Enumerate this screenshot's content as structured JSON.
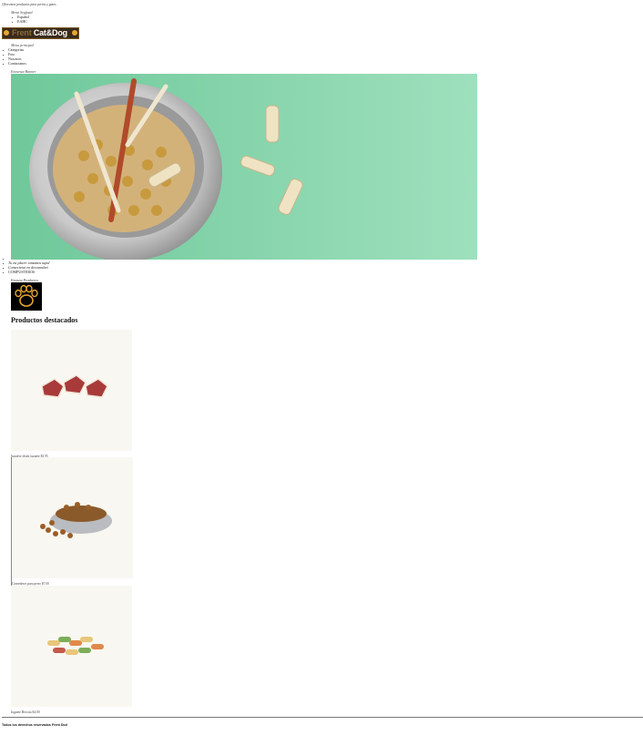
{
  "top_note": "Ofrecemos productos para perros y gatos",
  "lang_menu": {
    "title": "Menú Segfuzal",
    "items": [
      "Español",
      "EAHC"
    ]
  },
  "logo": {
    "text_dim": "Frent ",
    "text_bright": "Cat&Dog"
  },
  "main_menu": {
    "title": "Menu principal",
    "items": [
      "Categorías",
      "Foto",
      "Nosotros",
      "Contactanos"
    ]
  },
  "banner": {
    "label": "Encuesta Banner",
    "captions": [
      "",
      "Tu est placer tomamos tupid",
      "Consectetur en deccanalati",
      "COMPUSTEROS"
    ]
  },
  "products_section": {
    "label": "Encuest Productos",
    "title": "Productos destacados",
    "items": [
      {
        "caption": "Jugueve disen juguete $3.95",
        "kind": "treats"
      },
      {
        "caption": "Comederos para perro $7.00",
        "kind": "food-bowl"
      },
      {
        "caption": "Juguete Beccita $4.00",
        "kind": "biscuits"
      }
    ]
  },
  "footer": {
    "text": "Todos los derechos reservados Frent Dod"
  },
  "colors": {
    "banner_bg": "#8fd8b0",
    "footer_line": "#777777",
    "product_bg": "#f9f7f1"
  }
}
